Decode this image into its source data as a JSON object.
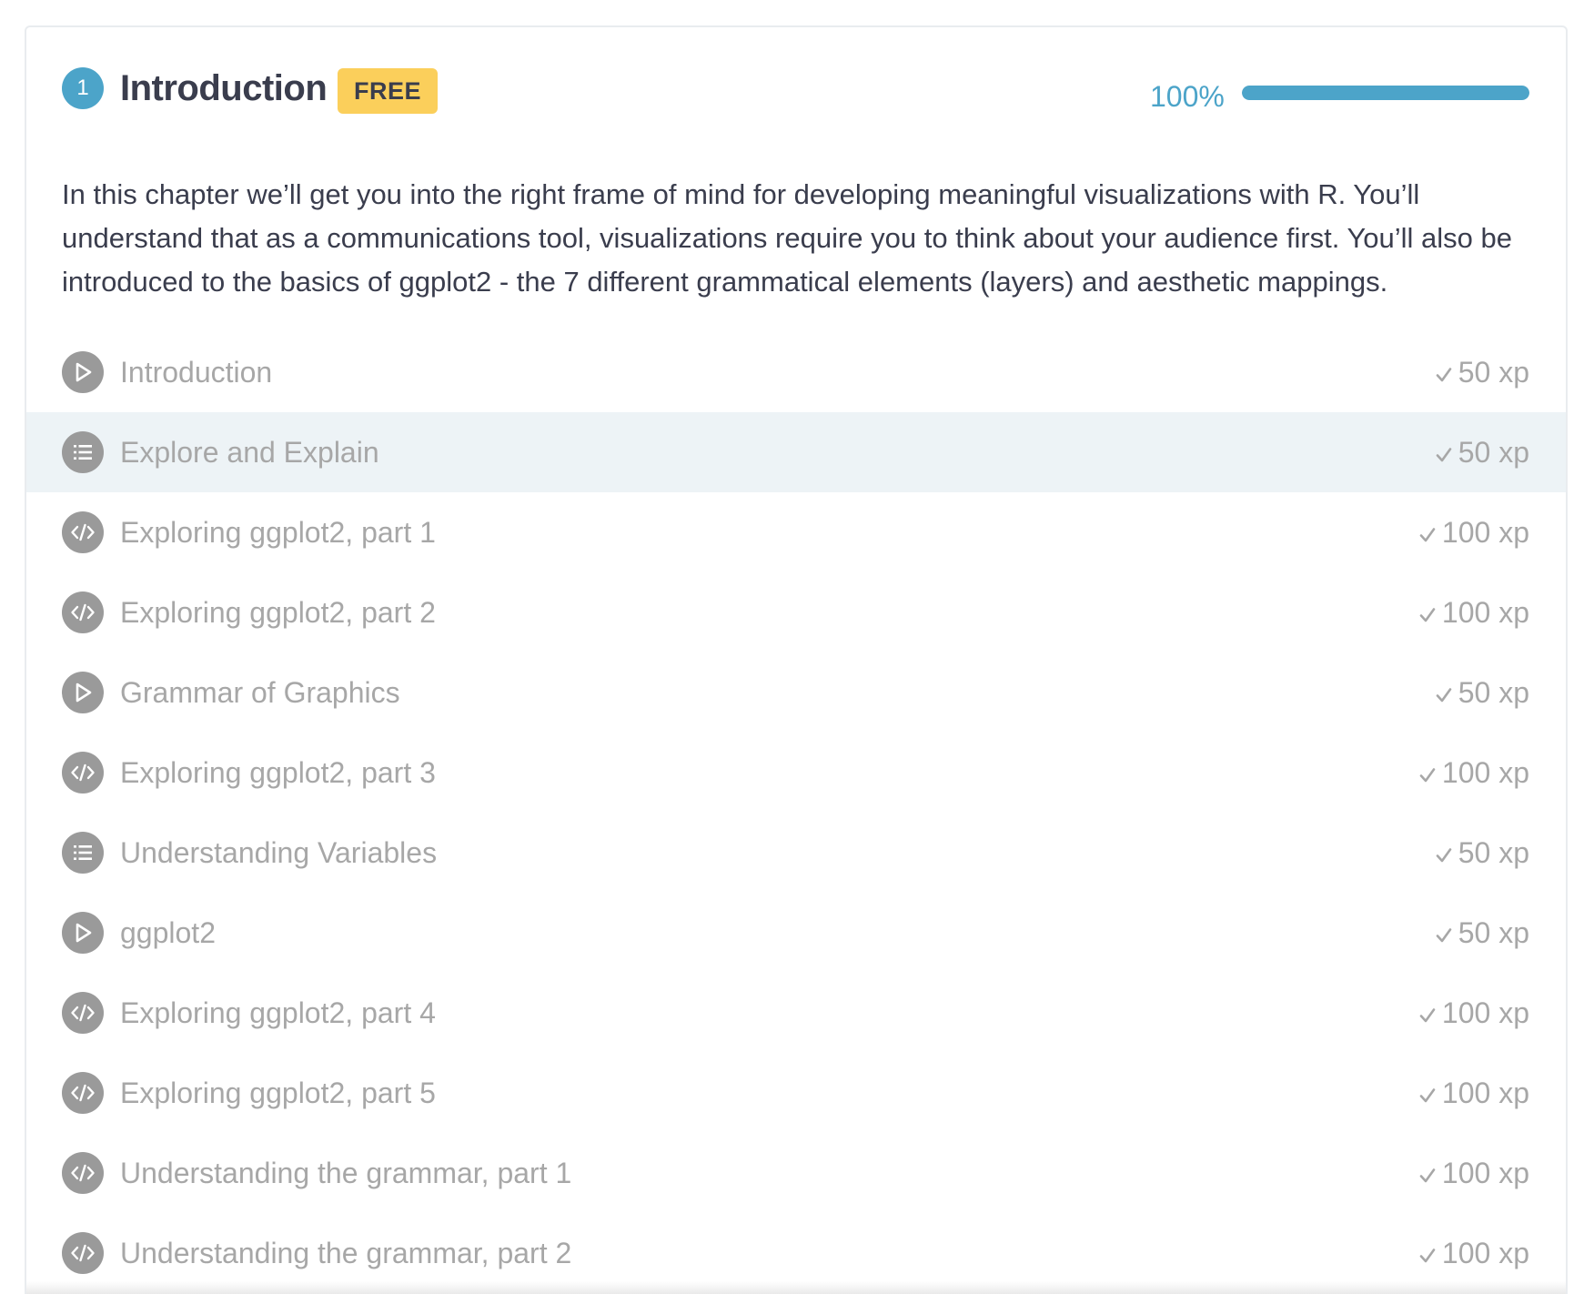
{
  "chapter": {
    "number": "1",
    "title": "Introduction",
    "badge": "FREE",
    "progress_label": "100%",
    "progress_value": 1.0,
    "description": "In this chapter we’ll get you into the right frame of mind for developing meaningful visualizations with R. You’ll understand that as a communications tool, visualizations require you to think about your audience first. You’ll also be introduced to the basics of ggplot2 - the 7 different grammatical elements (layers) and aesthetic mappings."
  },
  "colors": {
    "accent": "#4ca4c9",
    "badge": "#fbcf5b",
    "title_text": "#3a3d4d",
    "muted_text": "#a7a7a7",
    "icon_bg": "#9a9a9a",
    "row_hover": "#edf3f6"
  },
  "exercises": [
    {
      "icon": "play-icon",
      "title": "Introduction",
      "xp": "50 xp"
    },
    {
      "icon": "list-icon",
      "title": "Explore and Explain",
      "xp": "50 xp"
    },
    {
      "icon": "code-icon",
      "title": "Exploring ggplot2, part 1",
      "xp": "100 xp"
    },
    {
      "icon": "code-icon",
      "title": "Exploring ggplot2, part 2",
      "xp": "100 xp"
    },
    {
      "icon": "play-icon",
      "title": "Grammar of Graphics",
      "xp": "50 xp"
    },
    {
      "icon": "code-icon",
      "title": "Exploring ggplot2, part 3",
      "xp": "100 xp"
    },
    {
      "icon": "list-icon",
      "title": "Understanding Variables",
      "xp": "50 xp"
    },
    {
      "icon": "play-icon",
      "title": "ggplot2",
      "xp": "50 xp"
    },
    {
      "icon": "code-icon",
      "title": "Exploring ggplot2, part 4",
      "xp": "100 xp"
    },
    {
      "icon": "code-icon",
      "title": "Exploring ggplot2, part 5",
      "xp": "100 xp"
    },
    {
      "icon": "code-icon",
      "title": "Understanding the grammar, part 1",
      "xp": "100 xp"
    },
    {
      "icon": "code-icon",
      "title": "Understanding the grammar, part 2",
      "xp": "100 xp"
    }
  ]
}
